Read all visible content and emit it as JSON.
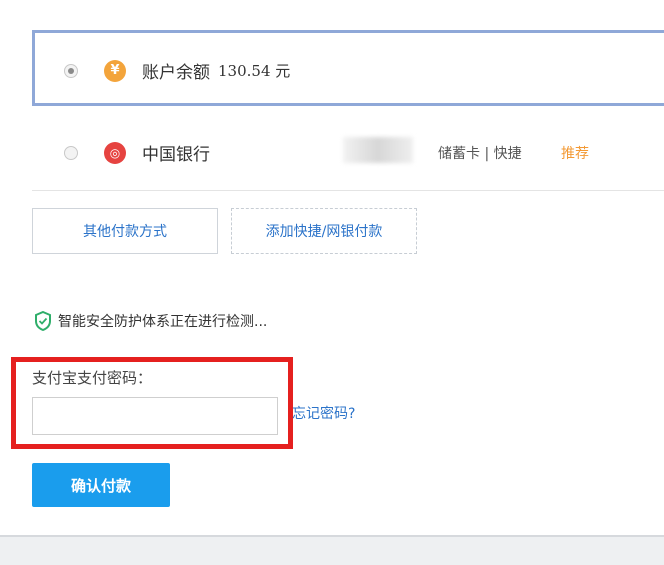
{
  "payment_options": [
    {
      "label": "账户余额",
      "amount": "130.54 元",
      "icon": "yuan-icon",
      "selected": true
    },
    {
      "label": "中国银行",
      "card_type": "储蓄卡 | 快捷",
      "badge": "推荐",
      "icon": "bank-icon",
      "selected": false
    }
  ],
  "buttons": {
    "other_methods": "其他付款方式",
    "add_quick_pay": "添加快捷/网银付款",
    "confirm": "确认付款"
  },
  "security": {
    "text": "智能安全防护体系正在进行检测..."
  },
  "password": {
    "label": "支付宝支付密码：",
    "value": "",
    "forgot": "忘记密码?"
  },
  "icons": {
    "yuan": "¥",
    "bank": "◎"
  },
  "colors": {
    "accent": "#1a9ded",
    "link": "#2b73c9",
    "highlight": "#e5201f",
    "recommend": "#f39a35"
  }
}
